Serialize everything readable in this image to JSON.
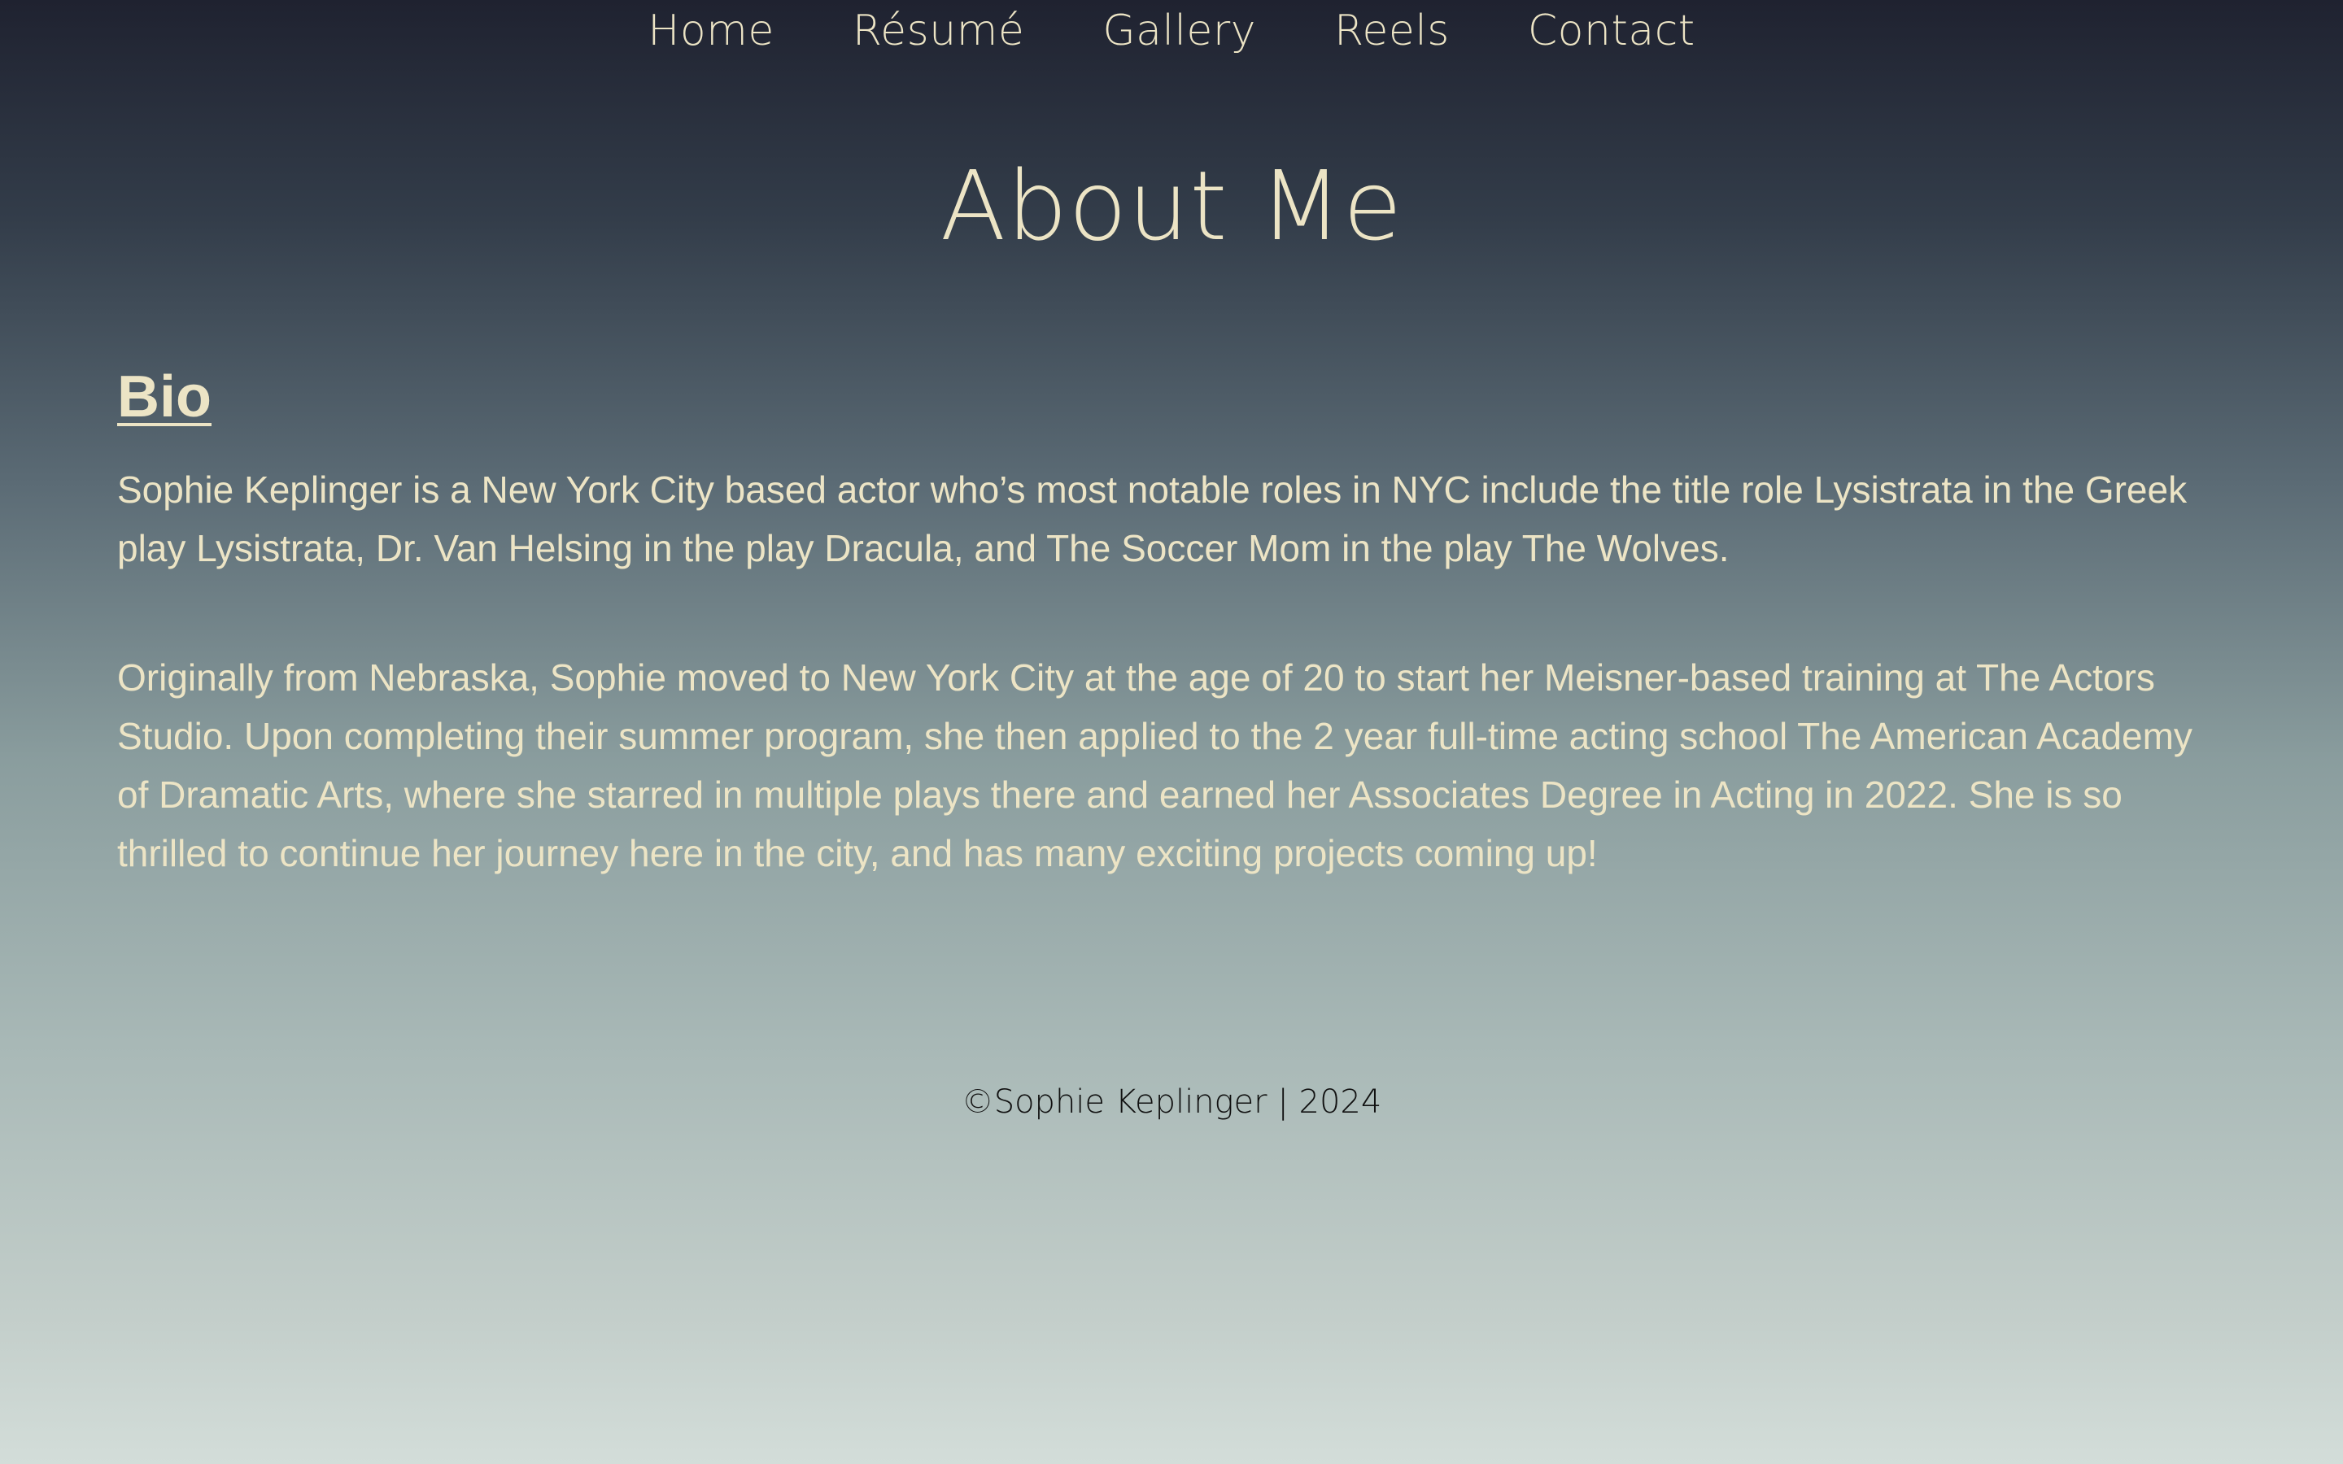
{
  "nav": {
    "items": [
      {
        "label": "Home"
      },
      {
        "label": "Résumé"
      },
      {
        "label": "Gallery"
      },
      {
        "label": "Reels"
      },
      {
        "label": "Contact"
      }
    ]
  },
  "page": {
    "title": "About Me"
  },
  "bio": {
    "heading": "Bio",
    "paragraphs": [
      "Sophie Keplinger is a New York City based actor who’s most notable roles in NYC include the title role Lysistrata in the Greek play Lysistrata, Dr. Van Helsing in the play Dracula, and The Soccer Mom in the play The Wolves.",
      "Originally from Nebraska, Sophie moved to New York City at the age of 20 to start her Meisner-based training at The Actors Studio. Upon completing their summer program, she then applied to the 2 year full-time acting school The American Academy of Dramatic Arts, where she starred in multiple plays there and earned her Associates Degree in Acting in 2022. She is so thrilled to continue her journey here in the city, and has many exciting projects coming up!"
    ]
  },
  "footer": {
    "text": "©Sophie Keplinger | 2024"
  },
  "colors": {
    "text_cream": "#ece4c5",
    "footer_text": "#111111",
    "gradient_top": "#1f2230",
    "gradient_bottom": "#d3ddd9"
  }
}
